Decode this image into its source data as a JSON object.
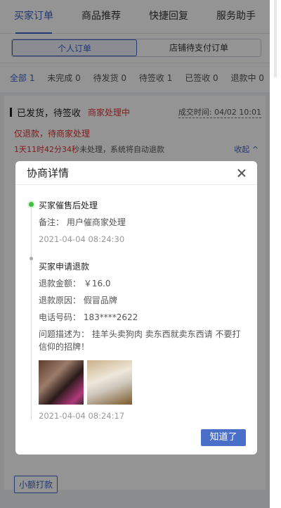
{
  "tabs": [
    "买家订单",
    "商品推荐",
    "快捷回复",
    "服务助手"
  ],
  "segments": [
    "个人订单",
    "店铺待支付订单"
  ],
  "filters": [
    "全部 1",
    "未完成 0",
    "待发货 0",
    "待签收 1",
    "已签收 0",
    "退款中 0"
  ],
  "card": {
    "status": "已发货，待签收",
    "merchant_status": "商家处理中",
    "deal_time": "成交时间: 04/02 10:01",
    "refund_note": "仅退款，待商家处理",
    "countdown": "1天11时42分34秒",
    "countdown_suffix": "未处理，系统将自动退款",
    "collapse": "收起 ^"
  },
  "tip_button": "小额打款",
  "modal": {
    "title": "协商详情",
    "event1": {
      "title": "买家催售后处理",
      "note": "备注：  用户催商家处理",
      "time": "2021-04-04 08:24:30"
    },
    "event2": {
      "title": "买家申请退款",
      "amount": "退款金额：  ￥16.0",
      "reason": "退款原因：  假冒品牌",
      "phone": "电话号码：  183****2622",
      "description": "问题描述为：  挂羊头卖狗肉 卖东西就卖东西请 不要打信仰的招牌！",
      "time": "2021-04-04 08:24:17"
    },
    "ok_button": "知道了"
  },
  "colors": {
    "accent": "#3a63c8",
    "alert": "#d33333",
    "success": "#3cc23c"
  }
}
